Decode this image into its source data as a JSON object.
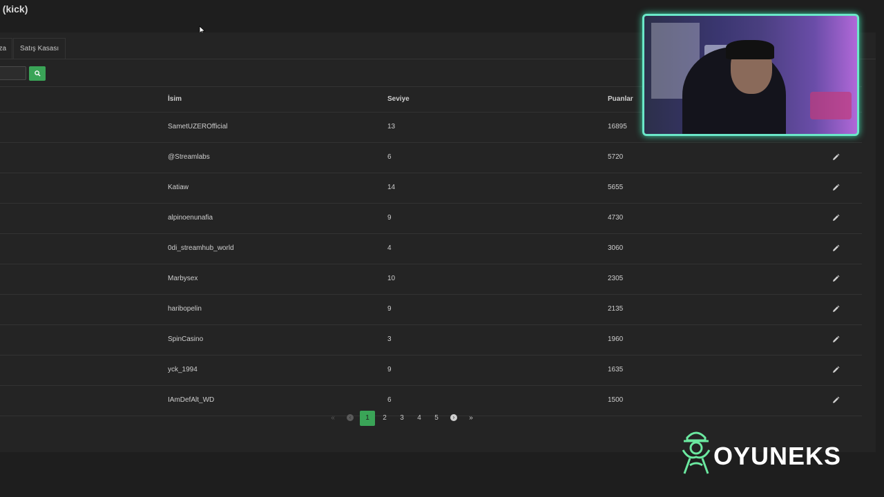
{
  "page": {
    "title": "i (kick)"
  },
  "tabs": [
    {
      "label": "za"
    },
    {
      "label": "Satış Kasası"
    }
  ],
  "search": {
    "value": "",
    "placeholder": ""
  },
  "table": {
    "headers": {
      "name": "İsim",
      "level": "Seviye",
      "points": "Puanlar"
    },
    "rows": [
      {
        "name": "SametUZEROfficial",
        "level": "13",
        "points": "16895"
      },
      {
        "name": "@Streamlabs",
        "level": "6",
        "points": "5720"
      },
      {
        "name": "Katiaw",
        "level": "14",
        "points": "5655"
      },
      {
        "name": "alpinoenunafia",
        "level": "9",
        "points": "4730"
      },
      {
        "name": "0di_streamhub_world",
        "level": "4",
        "points": "3060"
      },
      {
        "name": "Marbysex",
        "level": "10",
        "points": "2305"
      },
      {
        "name": "haribopelin",
        "level": "9",
        "points": "2135"
      },
      {
        "name": "SpinCasino",
        "level": "3",
        "points": "1960"
      },
      {
        "name": "yck_1994",
        "level": "9",
        "points": "1635"
      },
      {
        "name": "IAmDefAlt_WD",
        "level": "6",
        "points": "1500"
      }
    ]
  },
  "pagination": {
    "first": "«",
    "prev": "‹",
    "pages": [
      "1",
      "2",
      "3",
      "4",
      "5"
    ],
    "current": "1",
    "next": "›",
    "last": "»"
  },
  "brand": {
    "logo_text": "OYUNEKS",
    "color": "#6be8a0"
  },
  "colors": {
    "accent": "#3aa457",
    "background": "#1e1e1e",
    "panel": "#242424",
    "webcam_border": "#6be8c9"
  },
  "icons": {
    "search": "search-icon",
    "edit": "pencil-icon"
  }
}
